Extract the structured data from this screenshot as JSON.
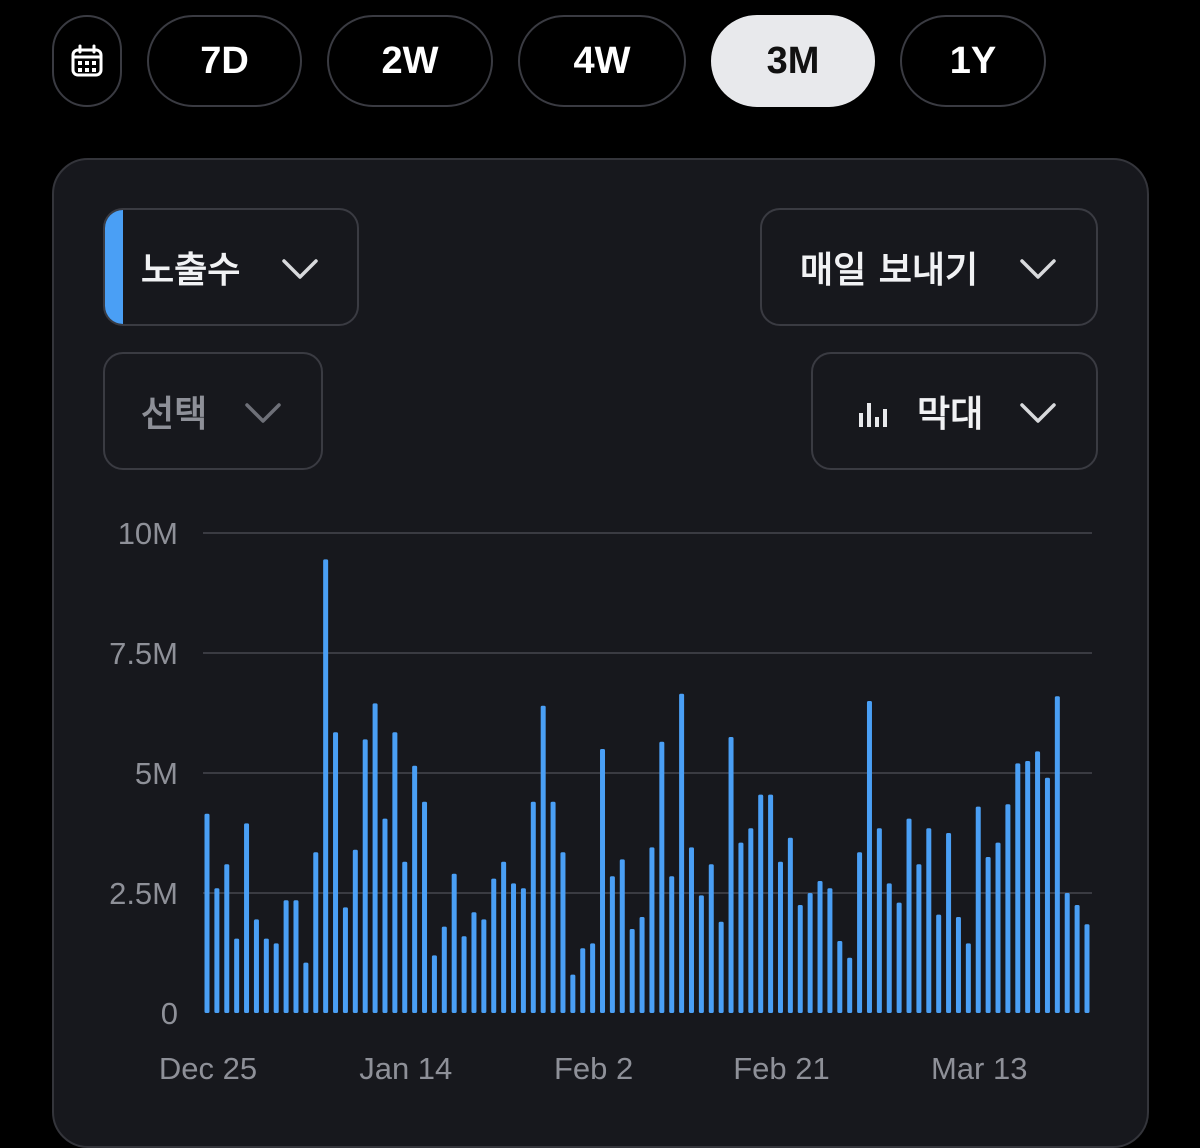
{
  "ranges": {
    "calendar_icon": "calendar-icon",
    "options": [
      "7D",
      "2W",
      "4W",
      "3M",
      "1Y"
    ],
    "selected": "3M"
  },
  "controls": {
    "metric": "노출수",
    "export": "매일 보내기",
    "compare": "선택",
    "chart_type": "막대",
    "chart_type_icon": "bar-chart-icon",
    "accent": "#4a9ff5"
  },
  "chart_data": {
    "type": "bar",
    "color": "#4a9ff5",
    "grid": true,
    "ylim": [
      0,
      10000000
    ],
    "yticks": [
      {
        "value": 0,
        "label": "0"
      },
      {
        "value": 2500000,
        "label": "2.5M"
      },
      {
        "value": 5000000,
        "label": "5M"
      },
      {
        "value": 7500000,
        "label": "7.5M"
      },
      {
        "value": 10000000,
        "label": "10M"
      }
    ],
    "xticks": [
      {
        "index": 0,
        "label": "Dec 25"
      },
      {
        "index": 20,
        "label": "Jan 14"
      },
      {
        "index": 39,
        "label": "Feb 2"
      },
      {
        "index": 58,
        "label": "Feb 21"
      },
      {
        "index": 78,
        "label": "Mar 13"
      }
    ],
    "values": [
      4150000,
      2600000,
      3100000,
      1550000,
      3950000,
      1950000,
      1550000,
      1450000,
      2350000,
      2350000,
      1050000,
      3350000,
      9450000,
      5850000,
      2200000,
      3400000,
      5700000,
      6450000,
      4050000,
      5850000,
      3150000,
      5150000,
      4400000,
      1200000,
      1800000,
      2900000,
      1600000,
      2100000,
      1950000,
      2800000,
      3150000,
      2700000,
      2600000,
      4400000,
      6400000,
      4400000,
      3350000,
      800000,
      1350000,
      1450000,
      5500000,
      2850000,
      3200000,
      1750000,
      2000000,
      3450000,
      5650000,
      2850000,
      6650000,
      3450000,
      2450000,
      3100000,
      1900000,
      5750000,
      3550000,
      3850000,
      4550000,
      4550000,
      3150000,
      3650000,
      2250000,
      2500000,
      2750000,
      2600000,
      1500000,
      1150000,
      3350000,
      6500000,
      3850000,
      2700000,
      2300000,
      4050000,
      3100000,
      3850000,
      2050000,
      3750000,
      2000000,
      1450000,
      4300000,
      3250000,
      3550000,
      4350000,
      5200000,
      5250000,
      5450000,
      4900000,
      6600000,
      2500000,
      2250000,
      1850000
    ]
  }
}
